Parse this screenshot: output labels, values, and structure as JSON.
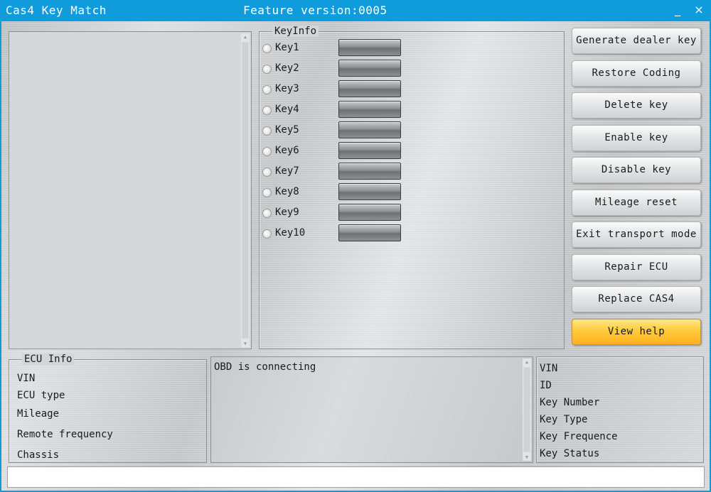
{
  "window": {
    "title": "Cas4 Key Match",
    "feature_version": "Feature version:0005",
    "minimize_glyph": "_",
    "close_glyph": "×"
  },
  "keyinfo": {
    "caption": "KeyInfo",
    "keys": [
      "Key1",
      "Key2",
      "Key3",
      "Key4",
      "Key5",
      "Key6",
      "Key7",
      "Key8",
      "Key9",
      "Key10"
    ]
  },
  "actions": [
    {
      "label": "Generate dealer key"
    },
    {
      "label": "Restore Coding"
    },
    {
      "label": "Delete key"
    },
    {
      "label": "Enable key"
    },
    {
      "label": "Disable key"
    },
    {
      "label": "Mileage reset"
    },
    {
      "label": "Exit transport mode"
    },
    {
      "label": "Repair ECU"
    },
    {
      "label": "Replace CAS4"
    },
    {
      "label": "View help"
    }
  ],
  "ecu_info": {
    "caption": "ECU Info",
    "fields": [
      "VIN",
      "ECU type",
      "Mileage",
      "Remote frequency",
      "Chassis"
    ]
  },
  "status": {
    "message": "OBD is connecting"
  },
  "key_detail": {
    "fields": [
      "VIN",
      "ID",
      "Key Number",
      "Key Type",
      "Key Frequence",
      "Key Status"
    ]
  },
  "colors": {
    "titlebar": "#109cdc",
    "help_button": "#ffcb3a"
  }
}
